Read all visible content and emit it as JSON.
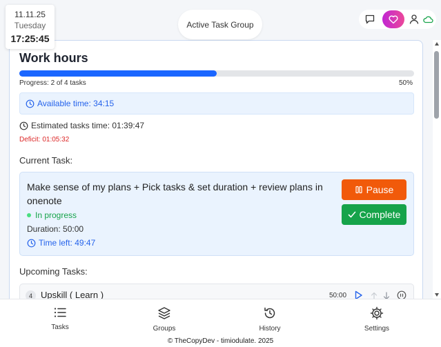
{
  "datetime": {
    "date": "11.11.25",
    "weekday": "Tuesday",
    "time": "17:25:45"
  },
  "header": {
    "group_button": "Active Task Group"
  },
  "top_icons": [
    "chat-icon",
    "heart-icon",
    "user-icon",
    "cloud-icon"
  ],
  "colors": {
    "accent": "#1a66ff",
    "pause": "#f15a0a",
    "complete": "#16a34a",
    "deficit": "#dc2626",
    "heart_gradient": [
      "#c026d3",
      "#ec4899"
    ]
  },
  "work": {
    "title": "Work hours",
    "progress_text": "Progress: 2 of 4 tasks",
    "progress_percent": "50%",
    "progress_fraction": 0.5,
    "available": "Available time: 34:15",
    "estimated": "Estimated tasks time: 01:39:47",
    "deficit": "Deficit: 01:05:32"
  },
  "current": {
    "heading": "Current Task:",
    "name": "Make sense of my plans + Pick tasks & set duration + review plans in onenote",
    "status": "In progress",
    "duration": "Duration: 50:00",
    "time_left": "Time left: 49:47",
    "pause_label": "Pause",
    "complete_label": "Complete"
  },
  "upcoming": {
    "heading": "Upcoming Tasks:",
    "items": [
      {
        "num": "4",
        "name": "Upskill ( Learn )",
        "duration": "50:00"
      }
    ]
  },
  "nav": [
    {
      "label": "Tasks",
      "icon": "list-icon"
    },
    {
      "label": "Groups",
      "icon": "layers-icon"
    },
    {
      "label": "History",
      "icon": "history-icon"
    },
    {
      "label": "Settings",
      "icon": "gear-icon"
    }
  ],
  "footer": "© TheCopyDev - timiodulate. 2025"
}
